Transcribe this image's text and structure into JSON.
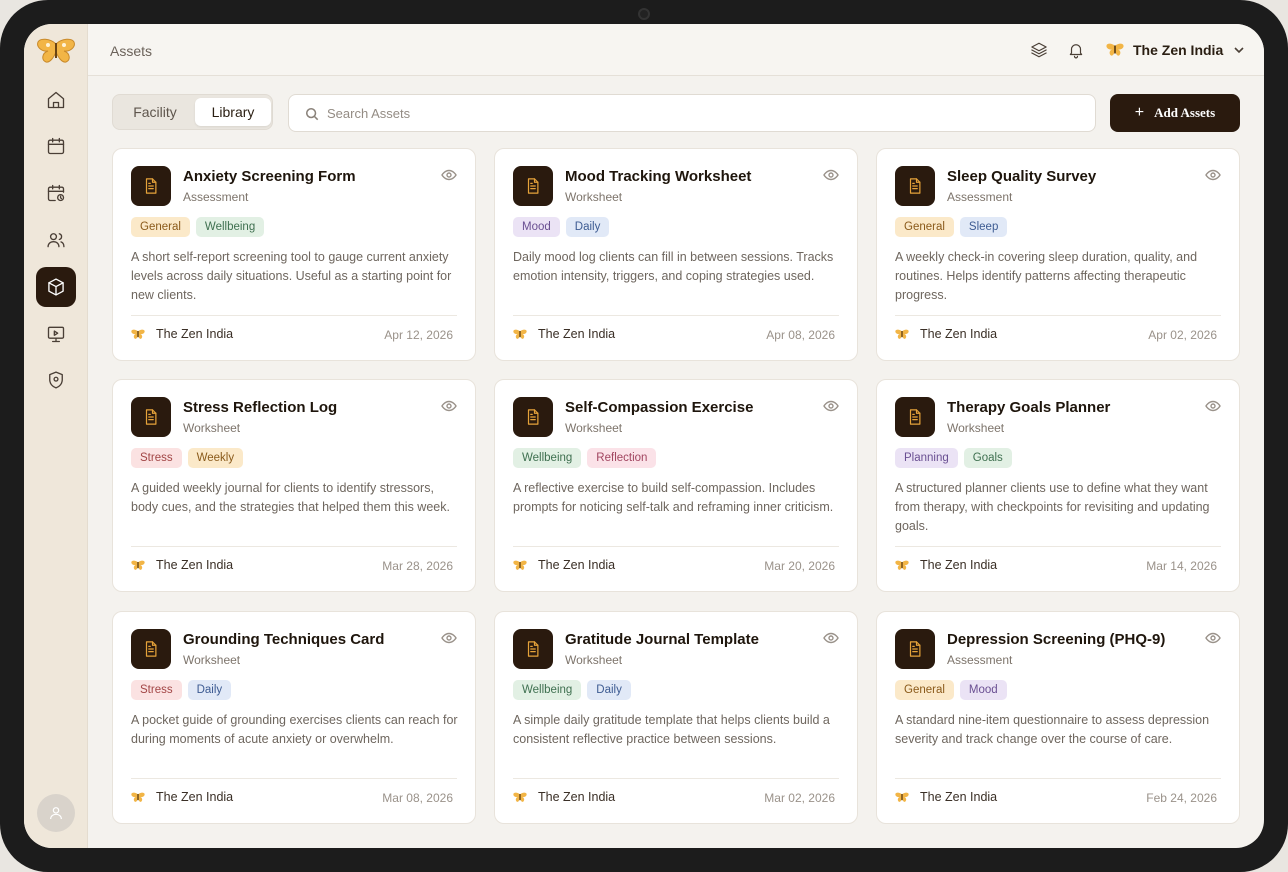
{
  "header": {
    "breadcrumb": "Assets",
    "account_name": "The Zen India"
  },
  "sidebar": {
    "items": [
      {
        "name": "home-icon"
      },
      {
        "name": "calendar-icon"
      },
      {
        "name": "calendar-clock-icon"
      },
      {
        "name": "users-icon"
      },
      {
        "name": "box-icon",
        "active": true
      },
      {
        "name": "presentation-icon"
      },
      {
        "name": "shield-icon"
      }
    ]
  },
  "toolbar": {
    "tabs": [
      "Facility",
      "Library"
    ],
    "active_tab": "Library",
    "search_placeholder": "Search Assets",
    "add_label": "Add Assets"
  },
  "colors": {
    "brand_dark": "#2a1a0e",
    "accent": "#e6a33a"
  },
  "cards": [
    {
      "title": "Anxiety Screening Form",
      "type": "Assessment",
      "tags": [
        "General",
        "Wellbeing"
      ],
      "description": "A short self-report screening tool to gauge current anxiety levels across daily situations. Useful as a starting point for new clients.",
      "author": "The Zen India",
      "date": "Apr 12, 2026"
    },
    {
      "title": "Mood Tracking Worksheet",
      "type": "Worksheet",
      "tags": [
        "Mood",
        "Daily"
      ],
      "description": "Daily mood log clients can fill in between sessions. Tracks emotion intensity, triggers, and coping strategies used.",
      "author": "The Zen India",
      "date": "Apr 08, 2026"
    },
    {
      "title": "Sleep Quality Survey",
      "type": "Assessment",
      "tags": [
        "General",
        "Sleep"
      ],
      "description": "A weekly check-in covering sleep duration, quality, and routines. Helps identify patterns affecting therapeutic progress.",
      "author": "The Zen India",
      "date": "Apr 02, 2026"
    },
    {
      "title": "Stress Reflection Log",
      "type": "Worksheet",
      "tags": [
        "Stress",
        "Weekly"
      ],
      "description": "A guided weekly journal for clients to identify stressors, body cues, and the strategies that helped them this week.",
      "author": "The Zen India",
      "date": "Mar 28, 2026"
    },
    {
      "title": "Self-Compassion Exercise",
      "type": "Worksheet",
      "tags": [
        "Wellbeing",
        "Reflection"
      ],
      "description": "A reflective exercise to build self-compassion. Includes prompts for noticing self-talk and reframing inner criticism.",
      "author": "The Zen India",
      "date": "Mar 20, 2026"
    },
    {
      "title": "Therapy Goals Planner",
      "type": "Worksheet",
      "tags": [
        "Planning",
        "Goals"
      ],
      "description": "A structured planner clients use to define what they want from therapy, with checkpoints for revisiting and updating goals.",
      "author": "The Zen India",
      "date": "Mar 14, 2026"
    },
    {
      "title": "Grounding Techniques Card",
      "type": "Worksheet",
      "tags": [
        "Stress",
        "Daily"
      ],
      "description": "A pocket guide of grounding exercises clients can reach for during moments of acute anxiety or overwhelm.",
      "author": "The Zen India",
      "date": "Mar 08, 2026"
    },
    {
      "title": "Gratitude Journal Template",
      "type": "Worksheet",
      "tags": [
        "Wellbeing",
        "Daily"
      ],
      "description": "A simple daily gratitude template that helps clients build a consistent reflective practice between sessions.",
      "author": "The Zen India",
      "date": "Mar 02, 2026"
    },
    {
      "title": "Depression Screening (PHQ-9)",
      "type": "Assessment",
      "tags": [
        "General",
        "Mood"
      ],
      "description": "A standard nine-item questionnaire to assess depression severity and track change over the course of care.",
      "author": "The Zen India",
      "date": "Feb 24, 2026"
    }
  ]
}
